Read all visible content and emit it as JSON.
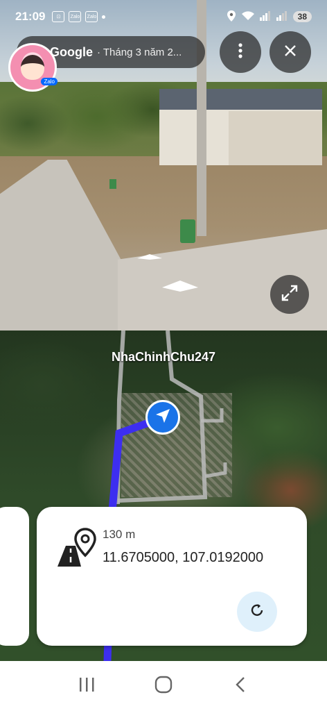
{
  "status_bar": {
    "time": "21:09",
    "app_badges": [
      "Zalo",
      "Zalo"
    ],
    "battery": "38"
  },
  "header": {
    "brand": "Google",
    "subtitle": "· Tháng 3 năm 2...",
    "more_icon": "more-vert-icon",
    "close_icon": "close-icon"
  },
  "avatar": {
    "tag": "Zalo"
  },
  "map": {
    "watermark": "NhaChinhChu247",
    "route_color": "#3d2ef0"
  },
  "info_card": {
    "distance": "130 m",
    "coordinates": "11.6705000, 107.0192000",
    "icon": "route-pin-icon",
    "refresh_icon": "refresh-icon"
  },
  "nav_bar": {
    "recent_icon": "recent-apps-icon",
    "home_icon": "home-icon",
    "back_icon": "back-icon"
  }
}
